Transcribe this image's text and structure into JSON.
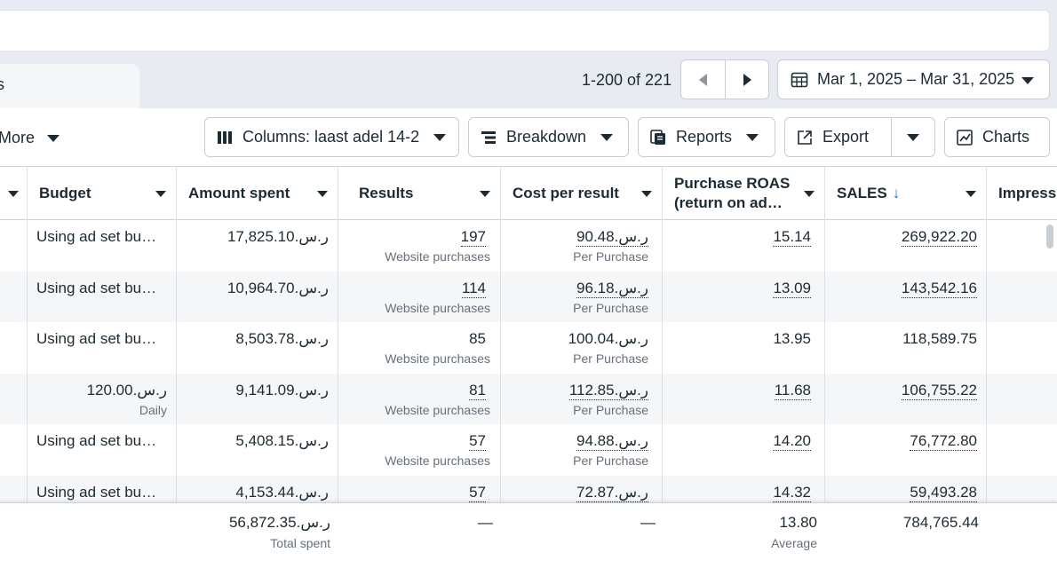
{
  "tab": {
    "label": "s"
  },
  "pagination": {
    "text": "1-200 of 221"
  },
  "date_range": {
    "label": "Mar 1, 2025 – Mar 31, 2025"
  },
  "toolbar": {
    "more_label": "More",
    "columns_label": "Columns: laast adel 14-2",
    "breakdown_label": "Breakdown",
    "reports_label": "Reports",
    "export_label": "Export",
    "charts_label": "Charts"
  },
  "columns": {
    "budget": "Budget",
    "amount_spent": "Amount spent",
    "results": "Results",
    "cost_per_result": "Cost per result",
    "roas_line1": "Purchase ROAS",
    "roas_line2": "(return on ad…",
    "sales": "SALES",
    "sales_sort": "↓",
    "impressions": "Impressi"
  },
  "rows": [
    {
      "budget": "Using ad set bu…",
      "budget_sub": "",
      "spent": "17,825.10.ر.س",
      "results": "197",
      "results_sub": "Website purchases",
      "cpr": "90.48.ر.س",
      "cpr_sub": "Per Purchase",
      "roas": "15.14",
      "sales": "269,922.20"
    },
    {
      "budget": "Using ad set bu…",
      "budget_sub": "",
      "spent": "10,964.70.ر.س",
      "results": "114",
      "results_sub": "Website purchases",
      "cpr": "96.18.ر.س",
      "cpr_sub": "Per Purchase",
      "roas": "13.09",
      "sales": "143,542.16"
    },
    {
      "budget": "Using ad set bu…",
      "budget_sub": "",
      "spent": "8,503.78.ر.س",
      "results": "85",
      "results_sub": "Website purchases",
      "cpr": "100.04.ر.س",
      "cpr_sub": "Per Purchase",
      "roas": "13.95",
      "sales": "118,589.75"
    },
    {
      "budget": "120.00.ر.س",
      "budget_sub": "Daily",
      "spent": "9,141.09.ر.س",
      "results": "81",
      "results_sub": "Website purchases",
      "cpr": "112.85.ر.س",
      "cpr_sub": "Per Purchase",
      "roas": "11.68",
      "sales": "106,755.22"
    },
    {
      "budget": "Using ad set bu…",
      "budget_sub": "",
      "spent": "5,408.15.ر.س",
      "results": "57",
      "results_sub": "Website purchases",
      "cpr": "94.88.ر.س",
      "cpr_sub": "Per Purchase",
      "roas": "14.20",
      "sales": "76,772.80"
    },
    {
      "budget": "Using ad set bu…",
      "budget_sub": "",
      "spent": "4,153.44.ر.س",
      "results": "57",
      "results_sub": "",
      "cpr": "72.87.ر.س",
      "cpr_sub": "",
      "roas": "14.32",
      "sales": "59,493.28"
    }
  ],
  "totals": {
    "spent": "56,872.35.ر.س",
    "spent_sub": "Total spent",
    "results": "—",
    "cpr": "—",
    "roas": "13.80",
    "roas_sub": "Average",
    "sales": "784,765.44"
  },
  "colors": {
    "accent": "#0a78be",
    "text": "#1c2b33",
    "muted": "#65707b"
  }
}
